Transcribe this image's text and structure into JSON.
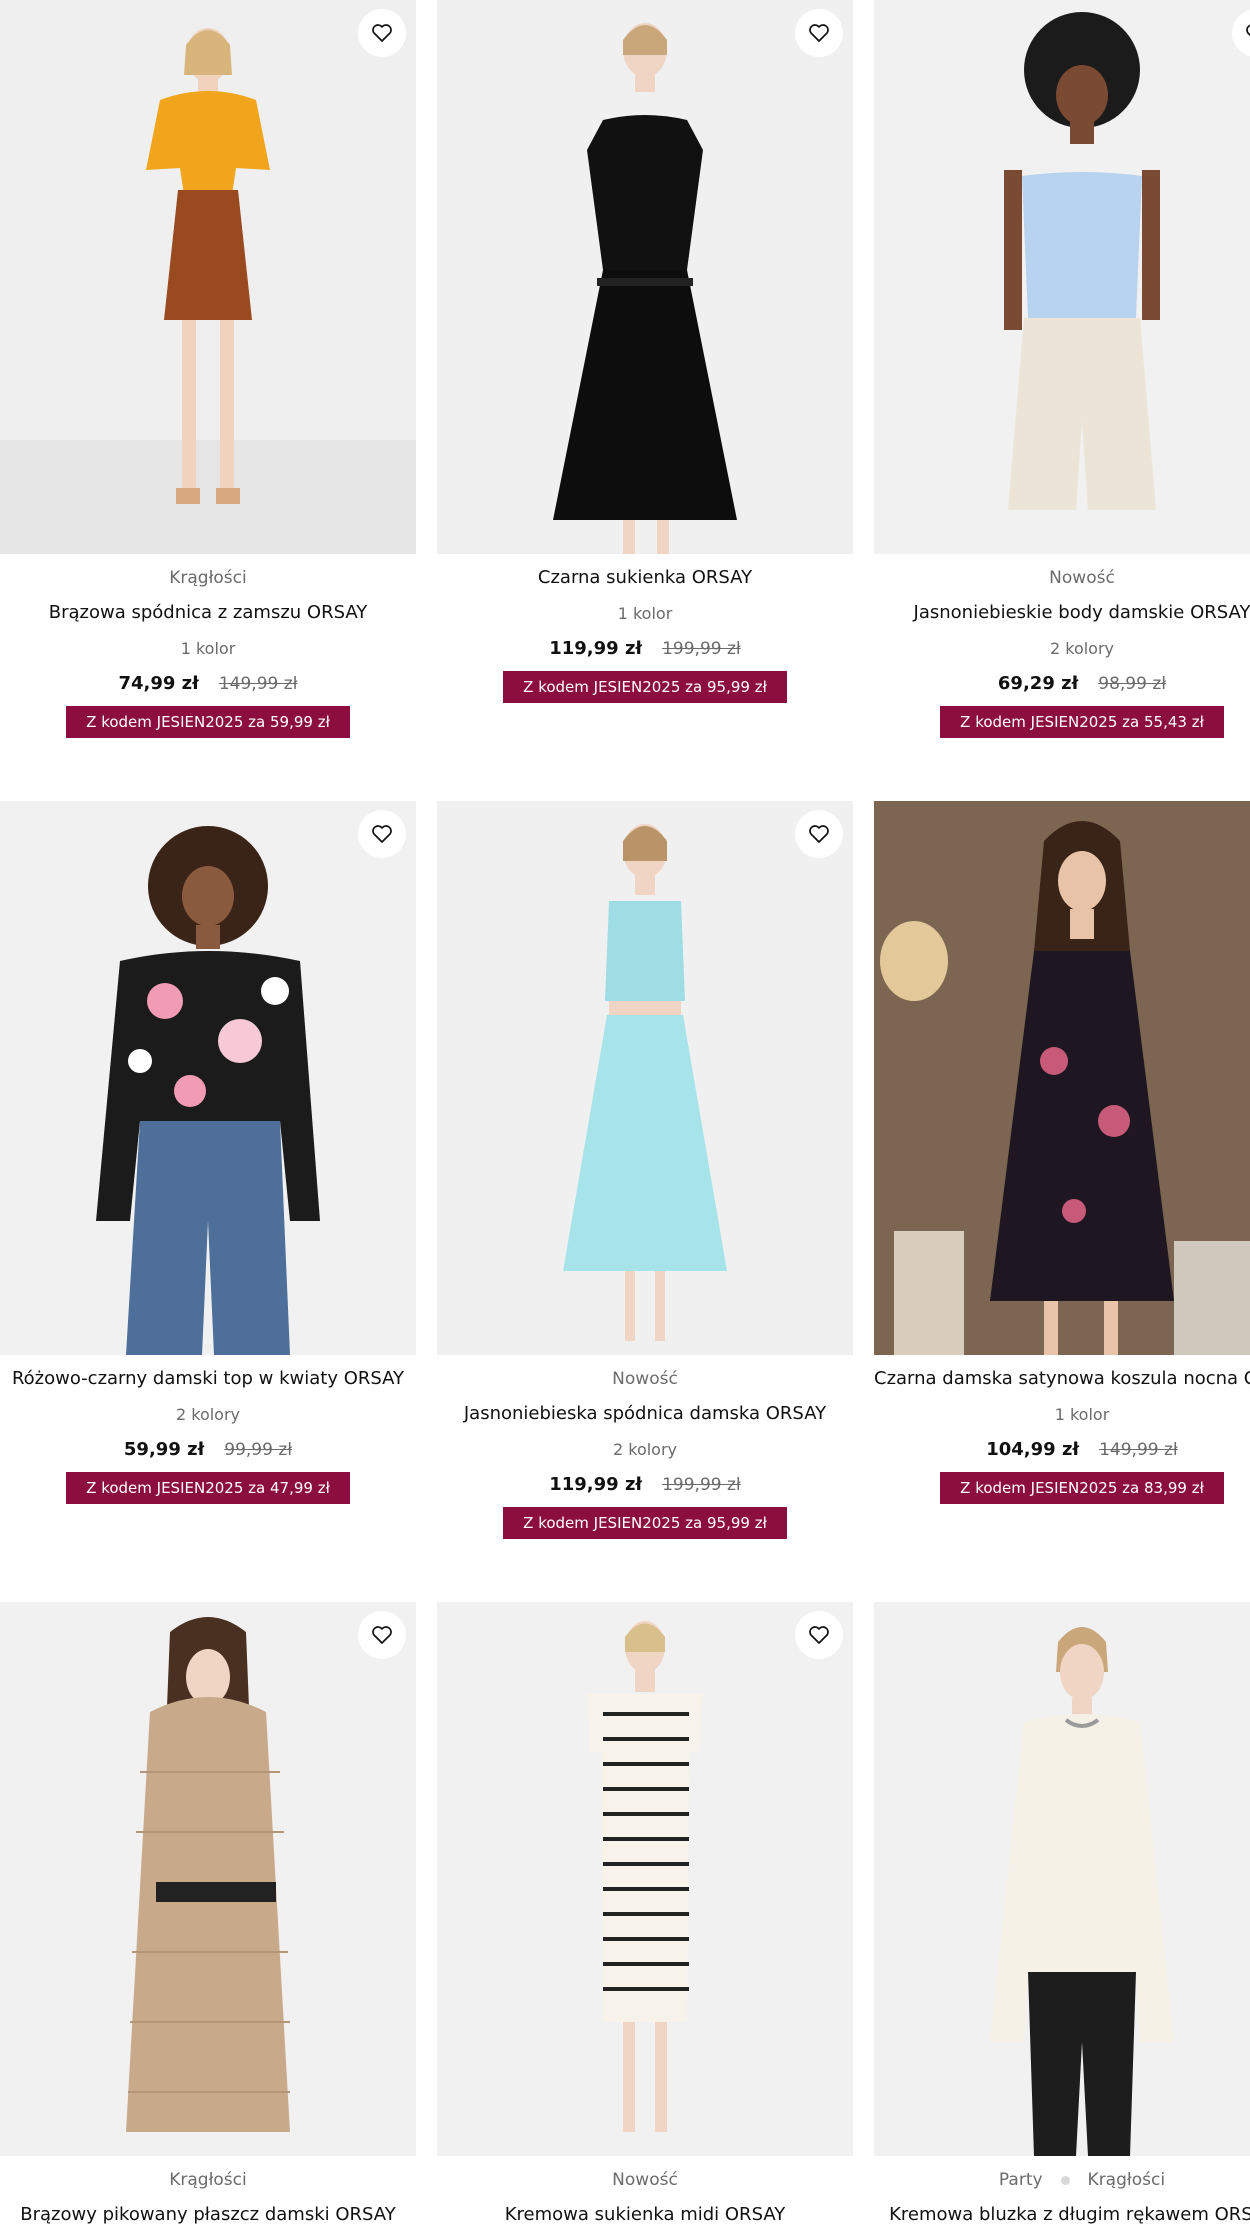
{
  "products": [
    {
      "tags": [
        "Krągłości"
      ],
      "title": "Brązowa spódnica z zamszu ORSAY",
      "colors": "1 kolor",
      "price": "74,99 zł",
      "old_price": "149,99 zł",
      "promo": "Z kodem JESIEN2025 za 59,99 zł"
    },
    {
      "tags": [],
      "title": "Czarna sukienka ORSAY",
      "colors": "1 kolor",
      "price": "119,99 zł",
      "old_price": "199,99 zł",
      "promo": "Z kodem JESIEN2025 za 95,99 zł"
    },
    {
      "tags": [
        "Nowość"
      ],
      "title": "Jasnoniebieskie body damskie ORSAY",
      "colors": "2 kolory",
      "price": "69,29 zł",
      "old_price": "98,99 zł",
      "promo": "Z kodem JESIEN2025 za 55,43 zł"
    },
    {
      "tags": [],
      "title": "Różowo-czarny damski top w kwiaty ORSAY",
      "colors": "2 kolory",
      "price": "59,99 zł",
      "old_price": "99,99 zł",
      "promo": "Z kodem JESIEN2025 za 47,99 zł"
    },
    {
      "tags": [
        "Nowość"
      ],
      "title": "Jasnoniebieska spódnica damska ORSAY",
      "colors": "2 kolory",
      "price": "119,99 zł",
      "old_price": "199,99 zł",
      "promo": "Z kodem JESIEN2025 za 95,99 zł"
    },
    {
      "tags": [],
      "title": "Czarna damska satynowa koszula nocna ORSAY",
      "colors": "1 kolor",
      "price": "104,99 zł",
      "old_price": "149,99 zł",
      "promo": "Z kodem JESIEN2025 za 83,99 zł"
    },
    {
      "tags": [
        "Krągłości"
      ],
      "title": "Brązowy pikowany płaszcz damski ORSAY",
      "colors": "",
      "price": "",
      "old_price": "",
      "promo": ""
    },
    {
      "tags": [
        "Nowość"
      ],
      "title": "Kremowa sukienka midi ORSAY",
      "colors": "",
      "price": "",
      "old_price": "",
      "promo": ""
    },
    {
      "tags": [
        "Party",
        "Krągłości"
      ],
      "title": "Kremowa bluzka z długim rękawem ORSAY",
      "colors": "",
      "price": "",
      "old_price": "",
      "promo": ""
    }
  ],
  "colors": {
    "promo_bg": "#8c0e3e",
    "promo_text": "#ffffff",
    "muted_text": "#6b6b6b"
  },
  "icons": {
    "favorite": "heart-outline-icon"
  }
}
